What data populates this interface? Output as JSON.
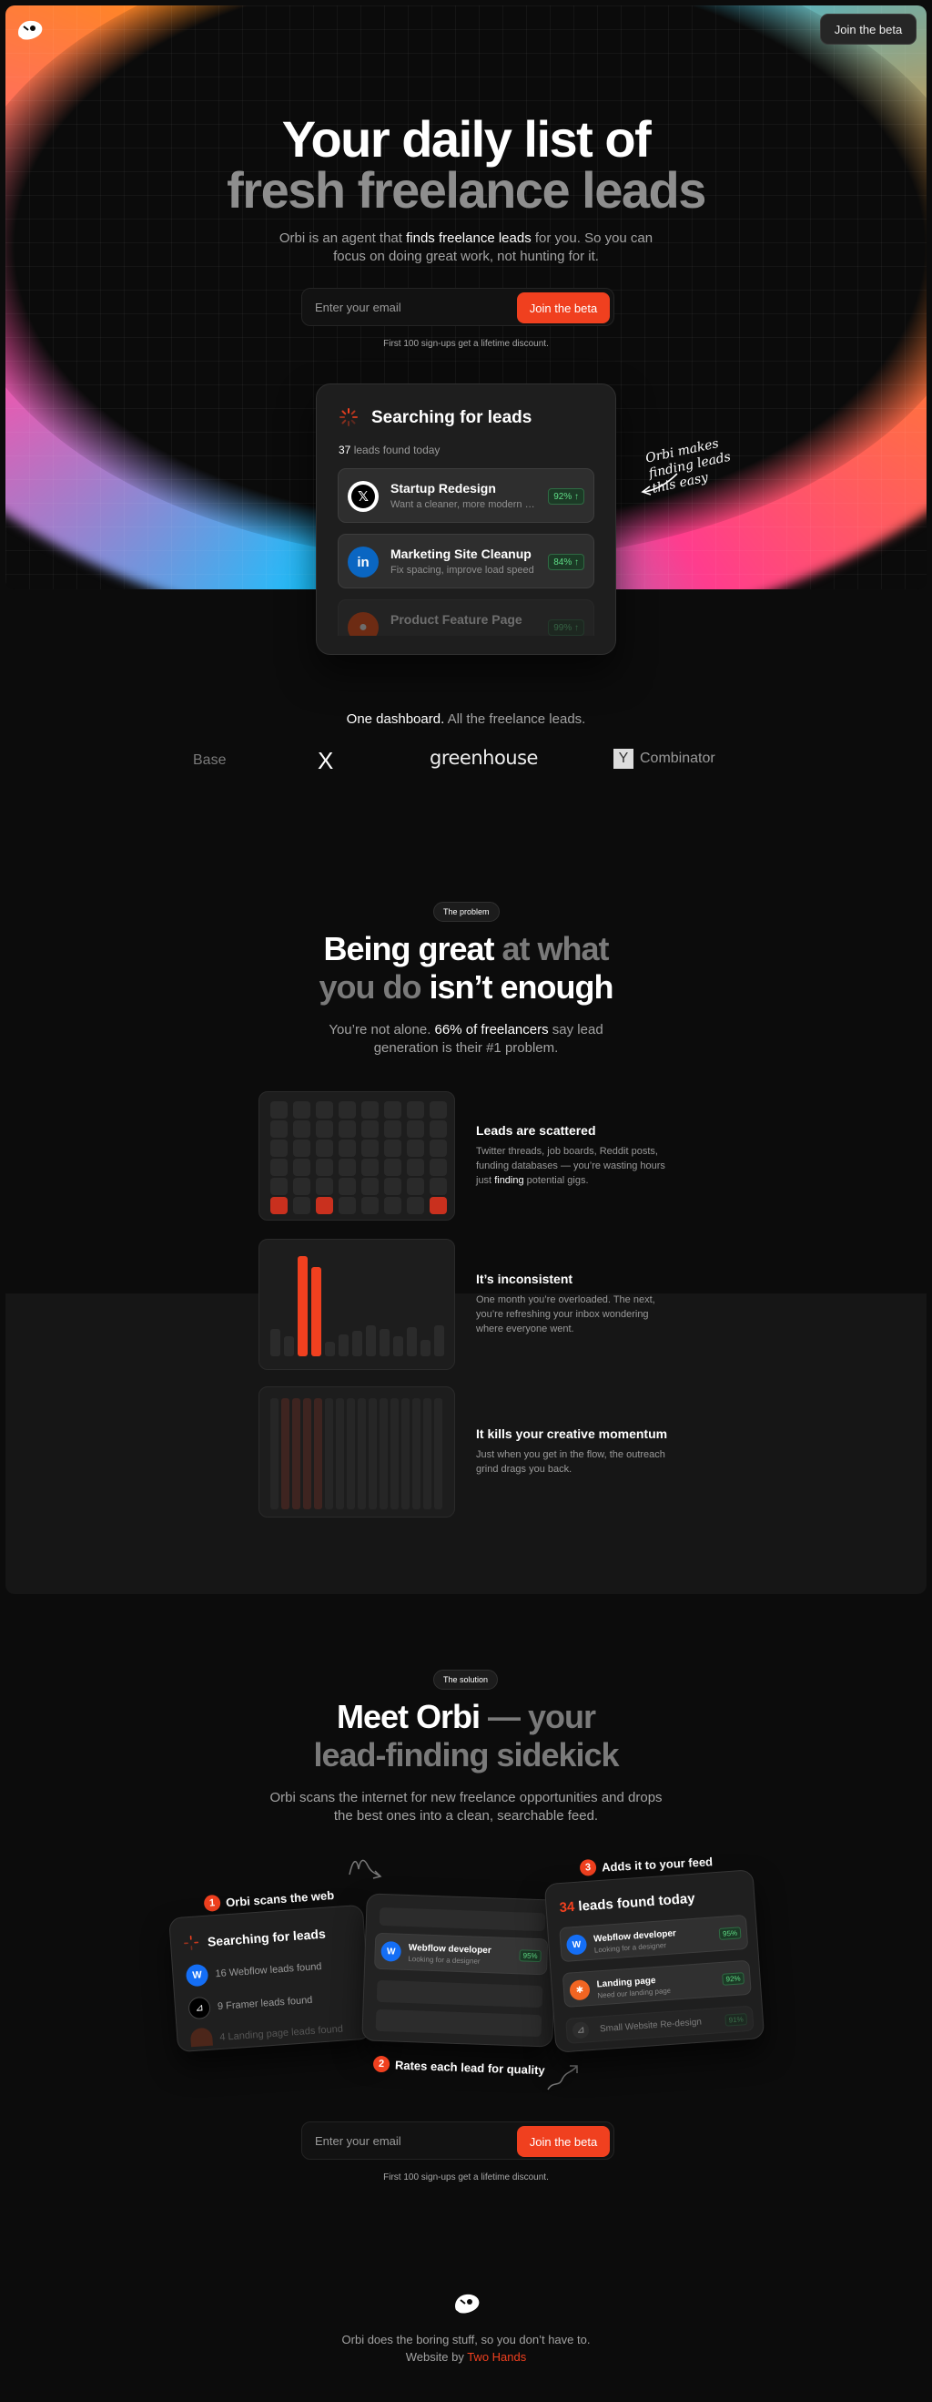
{
  "header": {
    "cta_label": "Join the beta"
  },
  "hero": {
    "title_line1": "Your daily list of",
    "title_line2": "fresh freelance leads",
    "sub_pre": "Orbi is an agent that ",
    "sub_bold": "finds freelance leads",
    "sub_post": " for you. So you can",
    "sub_line2": "focus on doing great work, not hunting for it.",
    "email_placeholder": "Enter your email",
    "join_label": "Join the beta",
    "note": "First 100 sign-ups get a lifetime discount.",
    "handwritten": "Orbi makes finding leads this easy"
  },
  "search_card": {
    "title": "Searching for leads",
    "count": "37",
    "count_label": " leads found today",
    "leads": [
      {
        "title": "Startup Redesign",
        "desc": "Want a cleaner, more modern look",
        "score": "92%",
        "icon": "x-logo-icon"
      },
      {
        "title": "Marketing Site Cleanup",
        "desc": "Fix spacing, improve load speed",
        "score": "84%",
        "icon": "linkedin-icon"
      },
      {
        "title": "Product Feature Page",
        "desc": "",
        "score": "99%",
        "icon": "reddit-icon"
      }
    ]
  },
  "partners": {
    "heading_bold": "One dashboard.",
    "heading_rest": " All the freelance leads.",
    "logos": [
      "Base",
      "X",
      "greenhouse",
      "Combinator"
    ]
  },
  "problem": {
    "tag": "The problem",
    "title_a": "Being great",
    "title_b": " at what",
    "title_c": "you do",
    "title_d": " isn’t enough",
    "sub_pre": "You’re not alone. ",
    "sub_bold": "66% of freelancers",
    "sub_post": " say lead",
    "sub_line2": "generation is their #1 problem.",
    "items": [
      {
        "title": "Leads are scattered",
        "line1": "Twitter threads, job boards, Reddit posts,",
        "line2": "funding databases — you’re wasting hours",
        "line3_pre": "just ",
        "line3_bold": "finding",
        "line3_post": " potential gigs."
      },
      {
        "title": "It’s inconsistent",
        "line1": "One month you’re overloaded. The next,",
        "line2": "you’re refreshing your inbox wondering",
        "line3": "where everyone went."
      },
      {
        "title": "It kills your creative momentum",
        "line1": "Just when you get in the flow, the outreach",
        "line2": "grind drags you back."
      }
    ]
  },
  "solution": {
    "tag": "The solution",
    "title_a": "Meet Orbi",
    "title_b": " — your",
    "title_c": "lead-finding sidekick",
    "sub_line1": "Orbi scans the internet for new freelance opportunities and drops",
    "sub_line2": "the best ones into a clean, searchable feed.",
    "steps": [
      {
        "num": "1",
        "label": "Orbi scans the web"
      },
      {
        "num": "2",
        "label": "Rates each lead for quality"
      },
      {
        "num": "3",
        "label": "Adds it to your feed"
      }
    ],
    "scan_card": {
      "title": "Searching for leads",
      "rows": [
        "16 Webflow leads found",
        "9 Framer leads found",
        "4 Landing page leads found"
      ]
    },
    "rate_card": {
      "title": "Webflow developer",
      "desc": "Looking for a designer to refresh",
      "score": "95%"
    },
    "feed_card": {
      "count": "34",
      "count_label": " leads found today",
      "items": [
        {
          "title": "Webflow developer",
          "desc": "Looking for a designer to refresh",
          "score": "95%"
        },
        {
          "title": "Landing page",
          "desc": "Need our landing page live by Friday",
          "score": "92%"
        },
        {
          "title": "Small Website Re-design",
          "desc": "",
          "score": "91%"
        }
      ]
    },
    "email_placeholder": "Enter your email",
    "join_label": "Join the beta",
    "note": "First 100 sign-ups get a lifetime discount."
  },
  "footer": {
    "line1": "Orbi does the boring stuff, so you don’t have to.",
    "line2_pre": "Website by ",
    "line2_link": "Two Hands"
  },
  "colors": {
    "accent": "#f0401f",
    "bg": "#0c0c0c",
    "card": "#1e1e1e",
    "green": "#5fdc86"
  }
}
